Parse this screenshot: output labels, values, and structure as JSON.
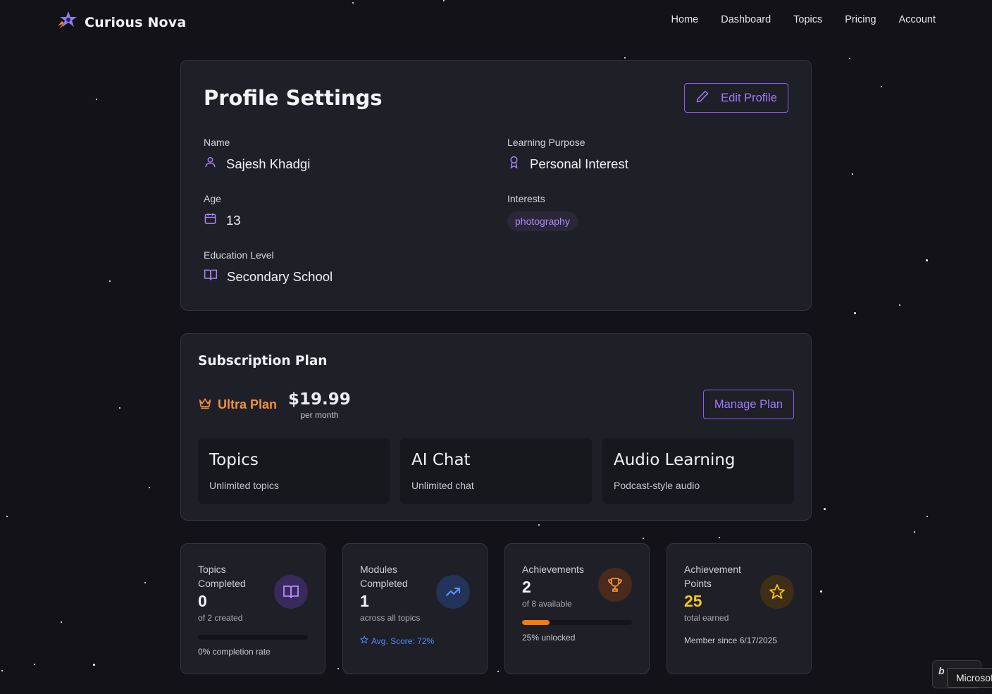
{
  "app": {
    "brand_name": "Curious Nova",
    "logo_icon": "rocket-star-logo"
  },
  "nav": {
    "items": [
      "Home",
      "Dashboard",
      "Topics",
      "Pricing",
      "Account"
    ]
  },
  "profile": {
    "title": "Profile Settings",
    "edit_label": "Edit Profile",
    "fields": {
      "name": {
        "label": "Name",
        "value": "Sajesh Khadgi",
        "icon": "user-icon"
      },
      "purpose": {
        "label": "Learning Purpose",
        "value": "Personal Interest",
        "icon": "award-icon"
      },
      "age": {
        "label": "Age",
        "value": "13",
        "icon": "calendar-icon"
      },
      "interests": {
        "label": "Interests",
        "tags": [
          "photography"
        ]
      },
      "education": {
        "label": "Education Level",
        "value": "Secondary School",
        "icon": "book-open-icon"
      }
    }
  },
  "subscription": {
    "title": "Subscription Plan",
    "plan_name": "Ultra Plan",
    "price": "$19.99",
    "period": "per month",
    "manage_label": "Manage Plan",
    "features": [
      {
        "title": "Topics",
        "desc": "Unlimited topics"
      },
      {
        "title": "AI Chat",
        "desc": "Unlimited chat"
      },
      {
        "title": "Audio Learning",
        "desc": "Podcast-style audio"
      }
    ]
  },
  "stats": {
    "topics": {
      "label": "Topics Completed",
      "value": "0",
      "sub": "of 2 created",
      "progress": 0,
      "foot": "0% completion rate"
    },
    "modules": {
      "label": "Modules Completed",
      "value": "1",
      "sub": "across all topics",
      "foot": "Avg. Score: 72%"
    },
    "achievements": {
      "label": "Achievements",
      "value": "2",
      "sub": "of 8 available",
      "progress": 0.25,
      "foot": "25% unlocked"
    },
    "points": {
      "label": "Achievement Points",
      "value": "25",
      "sub": "total earned",
      "foot": "Member since 6/17/2025"
    }
  },
  "colors": {
    "accent_purple": "#8b5cf6",
    "plan_orange": "#f0913a",
    "points_yellow": "#f5c518",
    "blue": "#4f8cf7",
    "background": "#121218",
    "card": "#1f1f28"
  },
  "overlay": {
    "tooltip_text": "Microsoft"
  }
}
